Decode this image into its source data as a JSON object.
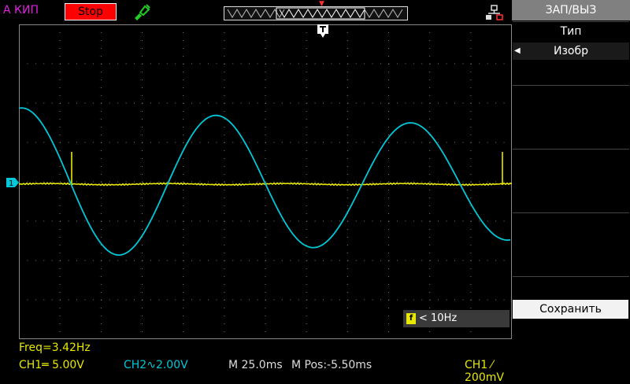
{
  "header": {
    "mode": "А КИП",
    "run_state": "Stop"
  },
  "menu": {
    "title": "ЗАП/ВЫЗ",
    "type_label": "Тип",
    "type_value": "Изобр",
    "save_label": "Сохранить"
  },
  "trigger_freq": "< 10Hz",
  "status": {
    "freq": "Freq=3.42Hz",
    "ch1": "CH1═ 5.00V",
    "ch2": "CH2∿2.00V",
    "timebase": "M 25.0ms",
    "mpos": "M Pos:-5.50ms",
    "trigger": "CH1 ⁄ 200mV"
  },
  "colors": {
    "ch1": "#e8e800",
    "ch2": "#00c8d8",
    "run_state_bg": "#ff0000"
  }
}
